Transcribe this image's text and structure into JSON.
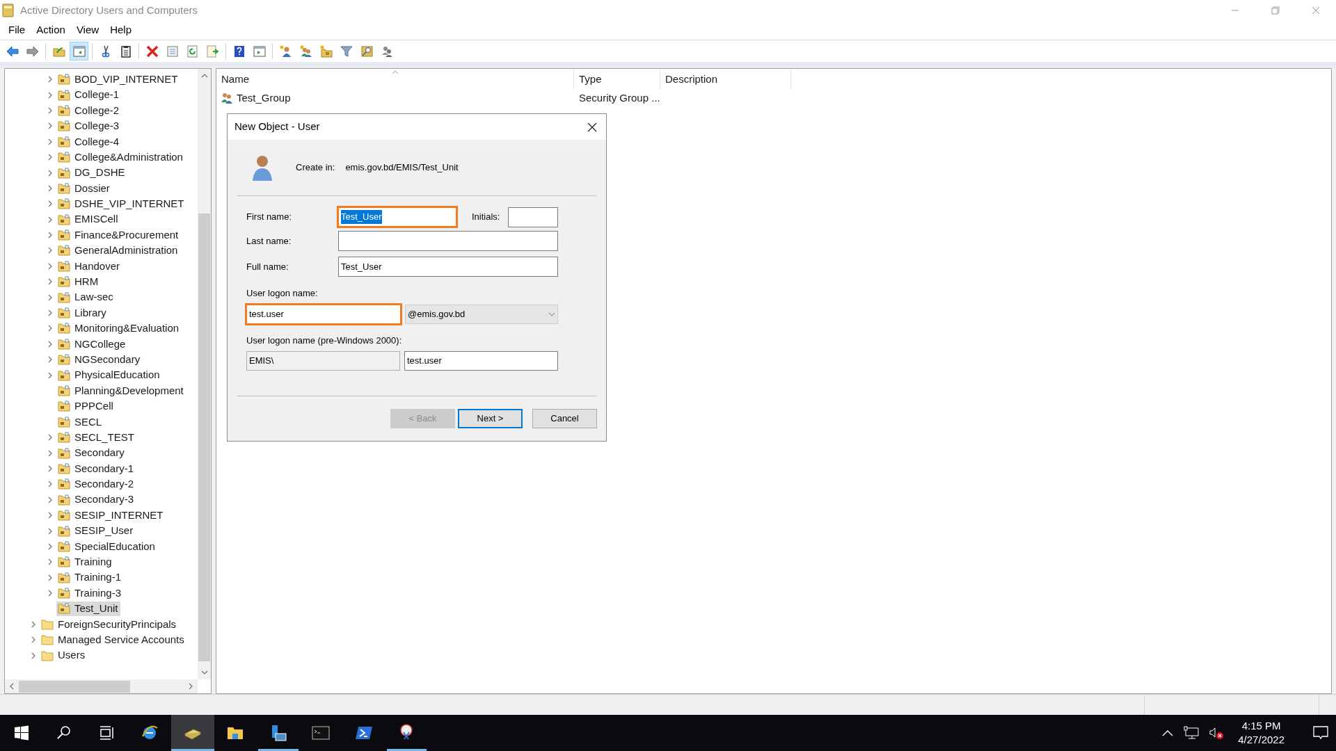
{
  "window": {
    "title": "Active Directory Users and Computers"
  },
  "menu": [
    "File",
    "Action",
    "View",
    "Help"
  ],
  "toolbar": {
    "buttons": [
      {
        "pressed": false
      },
      {
        "pressed": false
      },
      {
        "pressed": false
      },
      {
        "pressed": true
      },
      {
        "pressed": false
      },
      {
        "pressed": false
      },
      {
        "pressed": false
      },
      {
        "pressed": false
      },
      {
        "pressed": false
      },
      {
        "pressed": false
      },
      {
        "pressed": false
      },
      {
        "pressed": false
      },
      {
        "pressed": false
      },
      {
        "pressed": false
      },
      {
        "pressed": false
      },
      {
        "pressed": false
      },
      {
        "pressed": false
      },
      {
        "pressed": false
      }
    ]
  },
  "tree": {
    "items": [
      {
        "children": [
          {
            "label": "BOD_VIP_INTERNET",
            "kind": "ou",
            "expandable": true,
            "selected": false
          },
          {
            "label": "College-1",
            "kind": "ou",
            "expandable": true,
            "selected": false
          },
          {
            "label": "College-2",
            "kind": "ou",
            "expandable": true,
            "selected": false
          },
          {
            "label": "College-3",
            "kind": "ou",
            "expandable": true,
            "selected": false
          },
          {
            "label": "College-4",
            "kind": "ou",
            "expandable": true,
            "selected": false
          },
          {
            "label": "College&Administration",
            "kind": "ou",
            "expandable": true,
            "selected": false
          },
          {
            "label": "DG_DSHE",
            "kind": "ou",
            "expandable": true,
            "selected": false
          },
          {
            "label": "Dossier",
            "kind": "ou",
            "expandable": true,
            "selected": false
          },
          {
            "label": "DSHE_VIP_INTERNET",
            "kind": "ou",
            "expandable": true,
            "selected": false
          },
          {
            "label": "EMISCell",
            "kind": "ou",
            "expandable": true,
            "selected": false
          },
          {
            "label": "Finance&Procurement",
            "kind": "ou",
            "expandable": true,
            "selected": false
          },
          {
            "label": "GeneralAdministration",
            "kind": "ou",
            "expandable": true,
            "selected": false
          },
          {
            "label": "Handover",
            "kind": "ou",
            "expandable": true,
            "selected": false
          },
          {
            "label": "HRM",
            "kind": "ou",
            "expandable": true,
            "selected": false
          },
          {
            "label": "Law-sec",
            "kind": "ou",
            "expandable": true,
            "selected": false
          },
          {
            "label": "Library",
            "kind": "ou",
            "expandable": true,
            "selected": false
          },
          {
            "label": "Monitoring&Evaluation",
            "kind": "ou",
            "expandable": true,
            "selected": false
          },
          {
            "label": "NGCollege",
            "kind": "ou",
            "expandable": true,
            "selected": false
          },
          {
            "label": "NGSecondary",
            "kind": "ou",
            "expandable": true,
            "selected": false
          },
          {
            "label": "PhysicalEducation",
            "kind": "ou",
            "expandable": true,
            "selected": false
          },
          {
            "label": "Planning&Development",
            "kind": "ou",
            "expandable": false,
            "selected": false
          },
          {
            "label": "PPPCell",
            "kind": "ou",
            "expandable": false,
            "selected": false
          },
          {
            "label": "SECL",
            "kind": "ou",
            "expandable": false,
            "selected": false
          },
          {
            "label": "SECL_TEST",
            "kind": "ou",
            "expandable": true,
            "selected": false
          },
          {
            "label": "Secondary",
            "kind": "ou",
            "expandable": true,
            "selected": false
          },
          {
            "label": "Secondary-1",
            "kind": "ou",
            "expandable": true,
            "selected": false
          },
          {
            "label": "Secondary-2",
            "kind": "ou",
            "expandable": true,
            "selected": false
          },
          {
            "label": "Secondary-3",
            "kind": "ou",
            "expandable": true,
            "selected": false
          },
          {
            "label": "SESIP_INTERNET",
            "kind": "ou",
            "expandable": true,
            "selected": false
          },
          {
            "label": "SESIP_User",
            "kind": "ou",
            "expandable": true,
            "selected": false
          },
          {
            "label": "SpecialEducation",
            "kind": "ou",
            "expandable": true,
            "selected": false
          },
          {
            "label": "Training",
            "kind": "ou",
            "expandable": true,
            "selected": false
          },
          {
            "label": "Training-1",
            "kind": "ou",
            "expandable": true,
            "selected": false
          },
          {
            "label": "Training-3",
            "kind": "ou",
            "expandable": true,
            "selected": false
          },
          {
            "label": "Test_Unit",
            "kind": "ou",
            "expandable": false,
            "selected": true
          }
        ]
      },
      {
        "label": "ForeignSecurityPrincipals",
        "kind": "container",
        "expandable": true,
        "selected": false
      },
      {
        "label": "Managed Service Accounts",
        "kind": "container",
        "expandable": true,
        "selected": false
      },
      {
        "label": "Users",
        "kind": "container",
        "expandable": true,
        "selected": false
      }
    ]
  },
  "list": {
    "columns": [
      {
        "label": "Name",
        "sorted": true
      },
      {
        "label": "Type",
        "sorted": false
      },
      {
        "label": "Description",
        "sorted": false
      }
    ],
    "rows": [
      {
        "name": "Test_Group",
        "type": "Security Group ..."
      }
    ]
  },
  "dialog": {
    "title": "New Object - User",
    "create_in_label": "Create in:",
    "create_in_value": "emis.gov.bd/EMIS/Test_Unit",
    "first_name": {
      "label": "First name:",
      "value": "Test_User",
      "highlighted": true,
      "text_selected": true
    },
    "initials": {
      "label": "Initials:"
    },
    "last_name": {
      "label": "Last name:"
    },
    "full_name": {
      "label": "Full name:",
      "value": "Test_User"
    },
    "logon_name": {
      "label": "User logon name:",
      "value": "test.user",
      "highlighted": true,
      "domain": "@emis.gov.bd"
    },
    "pre2000": {
      "label": "User logon name (pre-Windows 2000):",
      "domain": "EMIS\\",
      "value": "test.user"
    },
    "buttons": [
      {
        "label": "< Back",
        "disabled": true,
        "default": false
      },
      {
        "label": "Next >",
        "disabled": false,
        "default": true
      },
      {
        "label": "Cancel",
        "disabled": false,
        "default": false
      }
    ]
  },
  "taskbar": {
    "apps": [
      {
        "running": false,
        "active": false
      },
      {
        "running": false,
        "active": false
      },
      {
        "running": false,
        "active": false
      },
      {
        "running": false,
        "active": false
      },
      {
        "running": true,
        "active": true
      },
      {
        "running": false,
        "active": false
      },
      {
        "running": true,
        "active": false
      },
      {
        "running": false,
        "active": false
      },
      {
        "running": false,
        "active": false
      },
      {
        "running": true,
        "active": false
      }
    ],
    "time": "4:15 PM",
    "date": "4/27/2022"
  }
}
